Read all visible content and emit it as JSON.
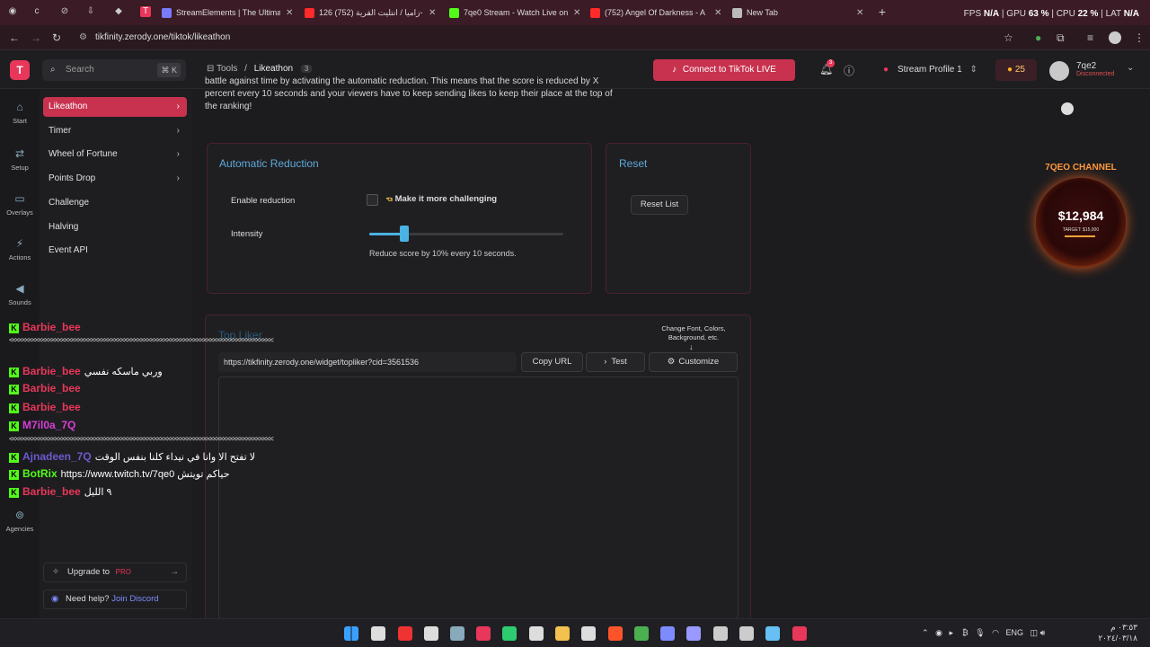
{
  "browser": {
    "tabs": [
      {
        "label": "StreamElements | The Ultimate",
        "color": "#7a7aff"
      },
      {
        "label": "زاميا / انتليت القرية (752) 126-",
        "color": "#ff2a2a"
      },
      {
        "label": "7qe0 Stream - Watch Live on Ki",
        "color": "#53fc18"
      },
      {
        "label": "(752) Angel Of Darkness - A",
        "color": "#ff2a2a"
      },
      {
        "label": "New Tab",
        "color": "#bbbbbb"
      }
    ],
    "new_tab": "+",
    "url": "tikfinity.zerody.one/tiktok/likeathon",
    "sysmon": {
      "fps_label": "FPS",
      "fps": "N/A",
      "gpu_label": "GPU",
      "gpu": "63 %",
      "cpu_label": "CPU",
      "cpu": "22 %",
      "lat_label": "LAT",
      "lat": "N/A"
    }
  },
  "header": {
    "logo": "T",
    "search_placeholder": "Search",
    "search_kbd": "⌘ K",
    "crumb_root": "Tools",
    "crumb_current": "Likeathon",
    "crumb_badge": "3",
    "connect_label": "Connect to TikTok LIVE",
    "notif_count": "3",
    "profile_label": "Stream Profile 1",
    "coins": "25",
    "user_name": "7qe2",
    "user_status": "Disconnected"
  },
  "rail": [
    {
      "label": "Start",
      "icon": "home-icon"
    },
    {
      "label": "Setup",
      "icon": "setup-icon"
    },
    {
      "label": "Overlays",
      "icon": "monitor-icon"
    },
    {
      "label": "Actions",
      "icon": "lightning-icon"
    },
    {
      "label": "Sounds",
      "icon": "speaker-icon"
    },
    {
      "label": "Agencies",
      "icon": "agency-icon"
    }
  ],
  "submenu": [
    {
      "label": "Likeathon",
      "arrow": true,
      "active": true
    },
    {
      "label": "Timer",
      "arrow": true
    },
    {
      "label": "Wheel of Fortune",
      "arrow": true
    },
    {
      "label": "Points Drop",
      "arrow": true
    },
    {
      "label": "Challenge",
      "arrow": false
    },
    {
      "label": "Halving",
      "arrow": false
    },
    {
      "label": "Event API",
      "arrow": false
    }
  ],
  "upgrade": {
    "label": "Upgrade to",
    "pro": "PRO"
  },
  "help": {
    "label": "Need help?",
    "link": "Join Discord"
  },
  "main": {
    "intro": "battle against time by activating the automatic reduction. This means that the score is reduced by X percent every 10 seconds and your viewers have to keep sending likes to keep their place at the top of the ranking!",
    "auto": {
      "title": "Automatic Reduction",
      "enable_label": "Enable reduction",
      "challenge_label": "Make it more challenging",
      "intensity_label": "Intensity",
      "intensity_value": 0.18,
      "hint": "Reduce score by 10% every 10 seconds."
    },
    "reset": {
      "title": "Reset",
      "button": "Reset List"
    },
    "top": {
      "title": "Top Liker",
      "customize_hint": "Change Font, Colors, Background, etc.",
      "widget_url": "https://tikfinity.zerody.one/widget/topliker?cid=3561536",
      "copy_label": "Copy URL",
      "test_label": "Test",
      "customize_label": "Customize"
    }
  },
  "chat": [
    {
      "user": "Barbie_bee",
      "color": "#e8375a",
      "msg": ""
    },
    {
      "user": "Barbie_bee",
      "color": "#e8375a",
      "msg": "وربي ماسكه نفسي"
    },
    {
      "user": "Barbie_bee",
      "color": "#e8375a",
      "msg": ""
    },
    {
      "user": "Barbie_bee",
      "color": "#e8375a",
      "msg": ""
    },
    {
      "user": "M7il0a_7Q",
      "color": "#d63fd6",
      "msg": ""
    },
    {
      "user": "Ajnadeen_7Q",
      "color": "#6a5acd",
      "msg": "لا تفتح الا وانا في نيداء كلنا بنفس الوقت"
    },
    {
      "user": "BotRix",
      "color": "#53fc18",
      "msg": "https://www.twitch.tv/7qe0 حياكم تويتش"
    },
    {
      "user": "Barbie_bee",
      "color": "#e8375a",
      "msg": "٩ الليل"
    }
  ],
  "chat_divider": "<<<<<<<<<<<<<<<<<<<<<<<<<<<<<<<<<<<<<<<<<<<<<<<<<<<<<<<<<<<<<<<<<<<<<<<<<<<<<<<<",
  "donation": {
    "title": "7QEO CHANNEL",
    "amount": "$12,984",
    "target": "TARGET: $15,000",
    "progress": 0.86
  },
  "taskbar": {
    "lang": "ENG",
    "time": "٠٣:٥٣ م",
    "date": "٢٠٢٤/٠٣/١٨"
  }
}
